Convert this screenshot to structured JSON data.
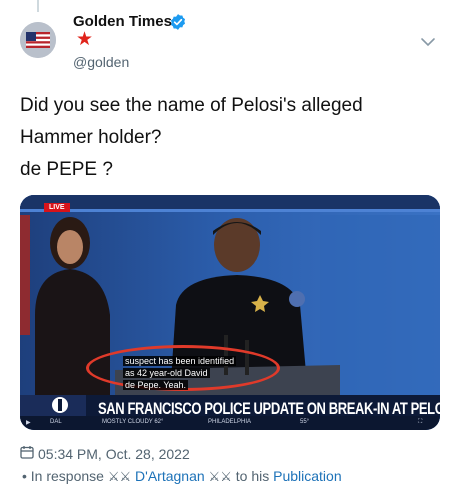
{
  "author": {
    "name": "Golden Times",
    "handle": "@golden",
    "verified_icon": "verified-badge-icon",
    "star_icon": "red-star-icon",
    "more_icon": "chevron-down-icon"
  },
  "tweet": {
    "lines": [
      "Did you see the name of Pelosi's alleged",
      "Hammer holder?",
      "de PEPE ?"
    ]
  },
  "media": {
    "live_label": "LIVE",
    "caption_lines": [
      "suspect has been identified",
      "as 42 year-old David",
      "de Pepe. Yeah."
    ],
    "headline": "SAN FRANCISCO POLICE UPDATE ON BREAK-IN AT PELOSI HOME",
    "ticker_items": [
      "DAL",
      "MOSTLY CLOUDY 62°",
      "PHILADELPHIA",
      "55°"
    ]
  },
  "footer": {
    "timestamp": "05:34 PM, Oct. 28, 2022",
    "reply_prefix": "• In response",
    "swords": "⚔⚔",
    "reply_user": "D'Artagnan",
    "reply_middle": "to his",
    "reply_target": "Publication"
  },
  "colors": {
    "accent_link": "#1d72b8",
    "muted": "#536471",
    "verified": "#1d9bf0",
    "star": "#e0241b",
    "annotation": "#e03a2a"
  }
}
